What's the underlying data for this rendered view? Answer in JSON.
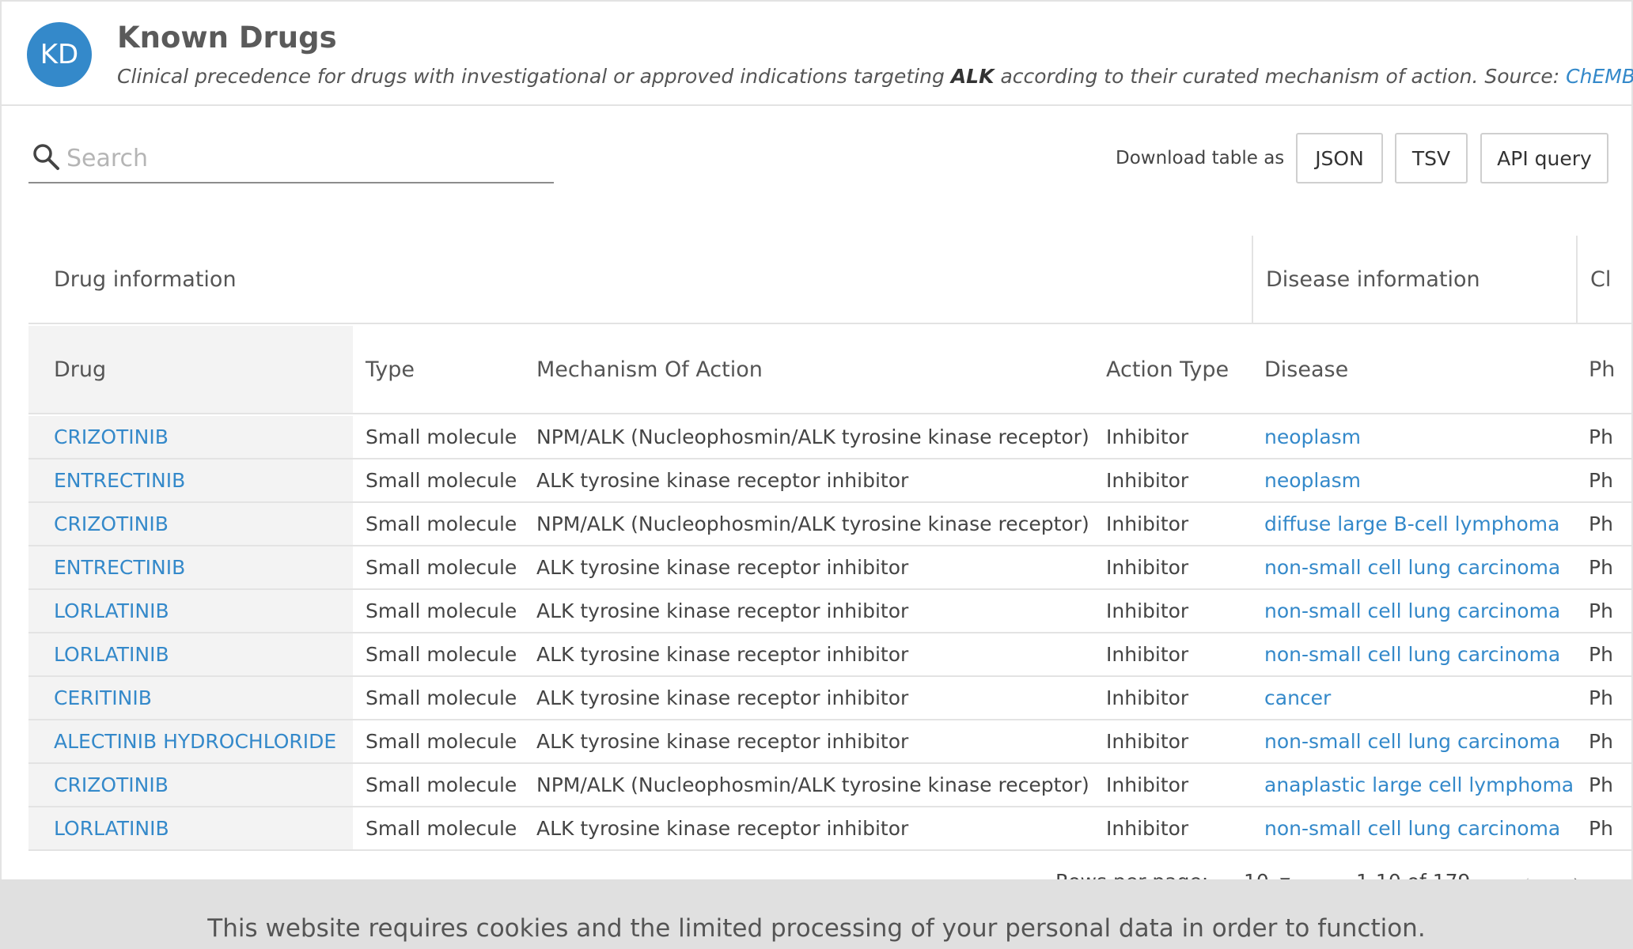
{
  "header": {
    "avatar_text": "KD",
    "title": "Known Drugs",
    "subtitle_pre": "Clinical precedence for drugs with investigational or approved indications targeting",
    "target": "ALK",
    "subtitle_post": "according to their curated mechanism of action. Source:",
    "source_link": "ChEMBL",
    "source_suffix": "."
  },
  "toolbar": {
    "search_placeholder": "Search",
    "download_label": "Download table as",
    "buttons": [
      "JSON",
      "TSV",
      "API query"
    ]
  },
  "table": {
    "groups": [
      "Drug information",
      "Disease information",
      "Cl"
    ],
    "columns": [
      "Drug",
      "Type",
      "Mechanism Of Action",
      "Action Type",
      "Disease",
      "Ph"
    ],
    "rows": [
      {
        "drug": "CRIZOTINIB",
        "type": "Small molecule",
        "moa": "NPM/ALK (Nucleophosmin/ALK tyrosine kinase receptor)",
        "action": "Inhibitor",
        "disease": "neoplasm",
        "phase": "Ph"
      },
      {
        "drug": "ENTRECTINIB",
        "type": "Small molecule",
        "moa": "ALK tyrosine kinase receptor inhibitor",
        "action": "Inhibitor",
        "disease": "neoplasm",
        "phase": "Ph"
      },
      {
        "drug": "CRIZOTINIB",
        "type": "Small molecule",
        "moa": "NPM/ALK (Nucleophosmin/ALK tyrosine kinase receptor)",
        "action": "Inhibitor",
        "disease": "diffuse large B-cell lymphoma",
        "phase": "Ph"
      },
      {
        "drug": "ENTRECTINIB",
        "type": "Small molecule",
        "moa": "ALK tyrosine kinase receptor inhibitor",
        "action": "Inhibitor",
        "disease": "non-small cell lung carcinoma",
        "phase": "Ph"
      },
      {
        "drug": "LORLATINIB",
        "type": "Small molecule",
        "moa": "ALK tyrosine kinase receptor inhibitor",
        "action": "Inhibitor",
        "disease": "non-small cell lung carcinoma",
        "phase": "Ph"
      },
      {
        "drug": "LORLATINIB",
        "type": "Small molecule",
        "moa": "ALK tyrosine kinase receptor inhibitor",
        "action": "Inhibitor",
        "disease": "non-small cell lung carcinoma",
        "phase": "Ph"
      },
      {
        "drug": "CERITINIB",
        "type": "Small molecule",
        "moa": "ALK tyrosine kinase receptor inhibitor",
        "action": "Inhibitor",
        "disease": "cancer",
        "phase": "Ph"
      },
      {
        "drug": "ALECTINIB HYDROCHLORIDE",
        "type": "Small molecule",
        "moa": "ALK tyrosine kinase receptor inhibitor",
        "action": "Inhibitor",
        "disease": "non-small cell lung carcinoma",
        "phase": "Ph"
      },
      {
        "drug": "CRIZOTINIB",
        "type": "Small molecule",
        "moa": "NPM/ALK (Nucleophosmin/ALK tyrosine kinase receptor)",
        "action": "Inhibitor",
        "disease": "anaplastic large cell lymphoma",
        "phase": "Ph"
      },
      {
        "drug": "LORLATINIB",
        "type": "Small molecule",
        "moa": "ALK tyrosine kinase receptor inhibitor",
        "action": "Inhibitor",
        "disease": "non-small cell lung carcinoma",
        "phase": "Ph"
      }
    ]
  },
  "pagination": {
    "rows_per_page_label": "Rows per page:",
    "rows_per_page_value": "10",
    "range": "1-10 of 179"
  },
  "cookie_banner": {
    "text": "This website requires cookies and the limited processing of your personal data in order to function."
  },
  "colors": {
    "accent": "#3489ca",
    "border": "#e3e3e3",
    "drug_column_bg": "#f3f3f3",
    "cookie_bg": "#e0e0e0"
  }
}
